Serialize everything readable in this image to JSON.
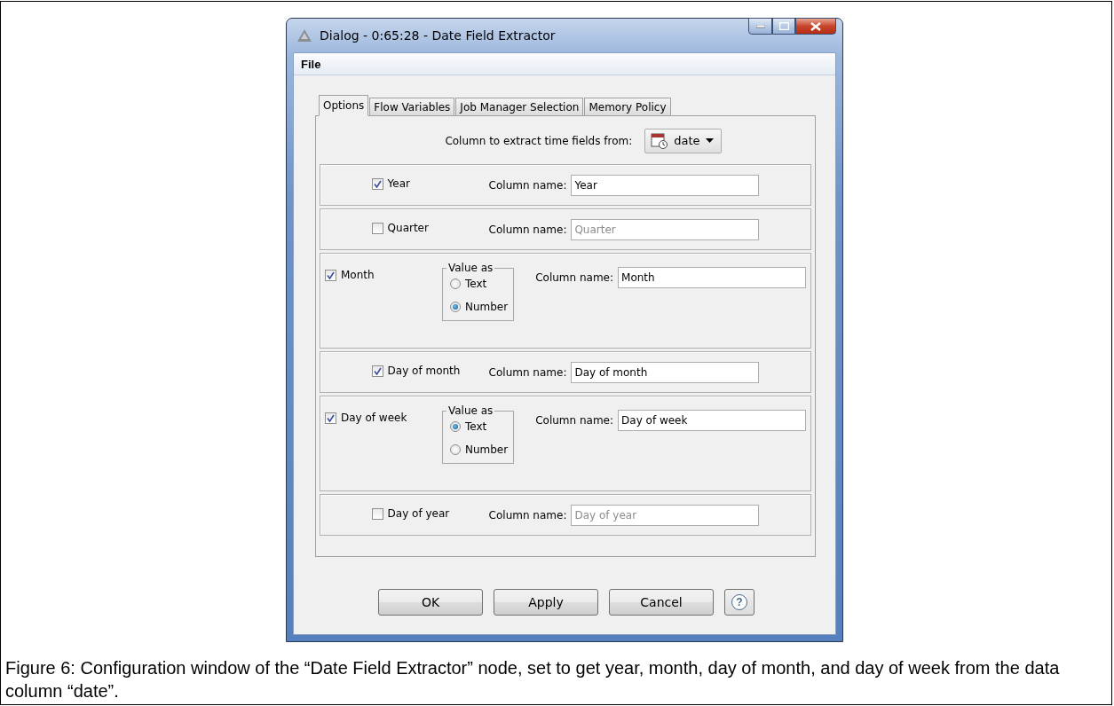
{
  "window": {
    "title": "Dialog - 0:65:28 - Date Field Extractor"
  },
  "menu": [
    "File"
  ],
  "tabs": [
    {
      "label": "Options",
      "selected": true
    },
    {
      "label": "Flow Variables",
      "selected": false
    },
    {
      "label": "Job Manager Selection",
      "selected": false
    },
    {
      "label": "Memory Policy",
      "selected": false
    }
  ],
  "source_column": {
    "label": "Column to extract time fields from:",
    "value": "date"
  },
  "fields": [
    {
      "label": "Year",
      "checked": true,
      "column_label": "Column name:",
      "column_value": "Year"
    },
    {
      "label": "Quarter",
      "checked": false,
      "column_label": "Column name:",
      "column_value": "Quarter"
    },
    {
      "label": "Month",
      "checked": true,
      "column_label": "Column name:",
      "column_value": "Month",
      "value_as": {
        "title": "Value as",
        "options": [
          {
            "label": "Text",
            "selected": false
          },
          {
            "label": "Number",
            "selected": true
          }
        ]
      }
    },
    {
      "label": "Day of month",
      "checked": true,
      "column_label": "Column name:",
      "column_value": "Day of month"
    },
    {
      "label": "Day of week",
      "checked": true,
      "column_label": "Column name:",
      "column_value": "Day of week",
      "value_as": {
        "title": "Value as",
        "options": [
          {
            "label": "Text",
            "selected": true
          },
          {
            "label": "Number",
            "selected": false
          }
        ]
      }
    },
    {
      "label": "Day of year",
      "checked": false,
      "column_label": "Column name:",
      "column_value": "Day of year"
    }
  ],
  "buttons": [
    "OK",
    "Apply",
    "Cancel"
  ],
  "help_button": "?",
  "caption": "Figure 6: Configuration window of the “Date Field Extractor” node, set to get year, month, day of month, and day of week from the data column “date”."
}
